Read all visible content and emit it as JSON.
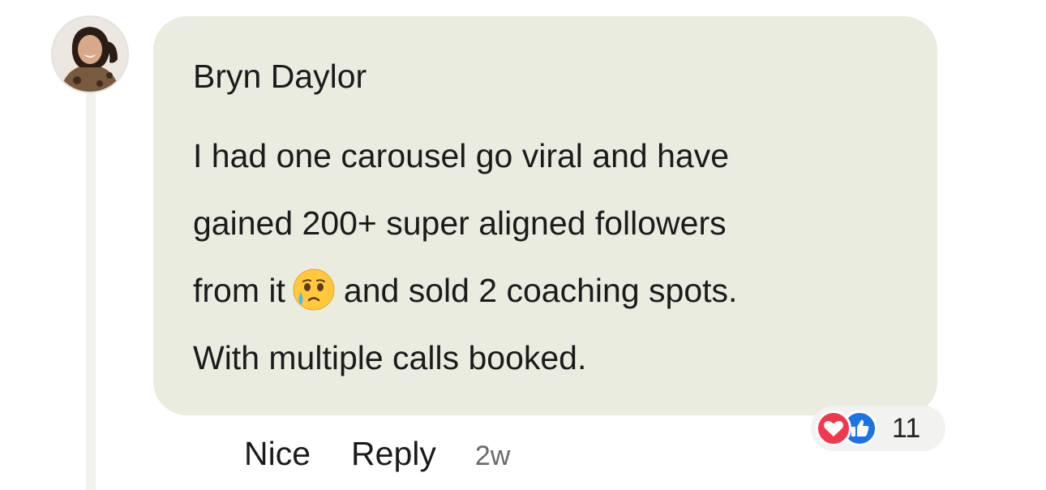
{
  "comment": {
    "author": "Bryn Daylor",
    "lines": [
      "I had one carousel go viral and have",
      "gained 200+ super aligned followers",
      "from it",
      "and sold 2 coaching spots.",
      "With multiple calls booked."
    ],
    "emoji": "face-holding-back-tears-icon"
  },
  "reactions": {
    "types": [
      "love-icon",
      "like-icon"
    ],
    "count": "11",
    "colors": {
      "love": "#f0384f",
      "like": "#1b74e4"
    }
  },
  "actions": {
    "nice_label": "Nice",
    "reply_label": "Reply",
    "timestamp": "2w"
  },
  "colors": {
    "bubble": "#e9ecdf",
    "text": "#1b1b1b",
    "muted": "#6a6a6a"
  }
}
